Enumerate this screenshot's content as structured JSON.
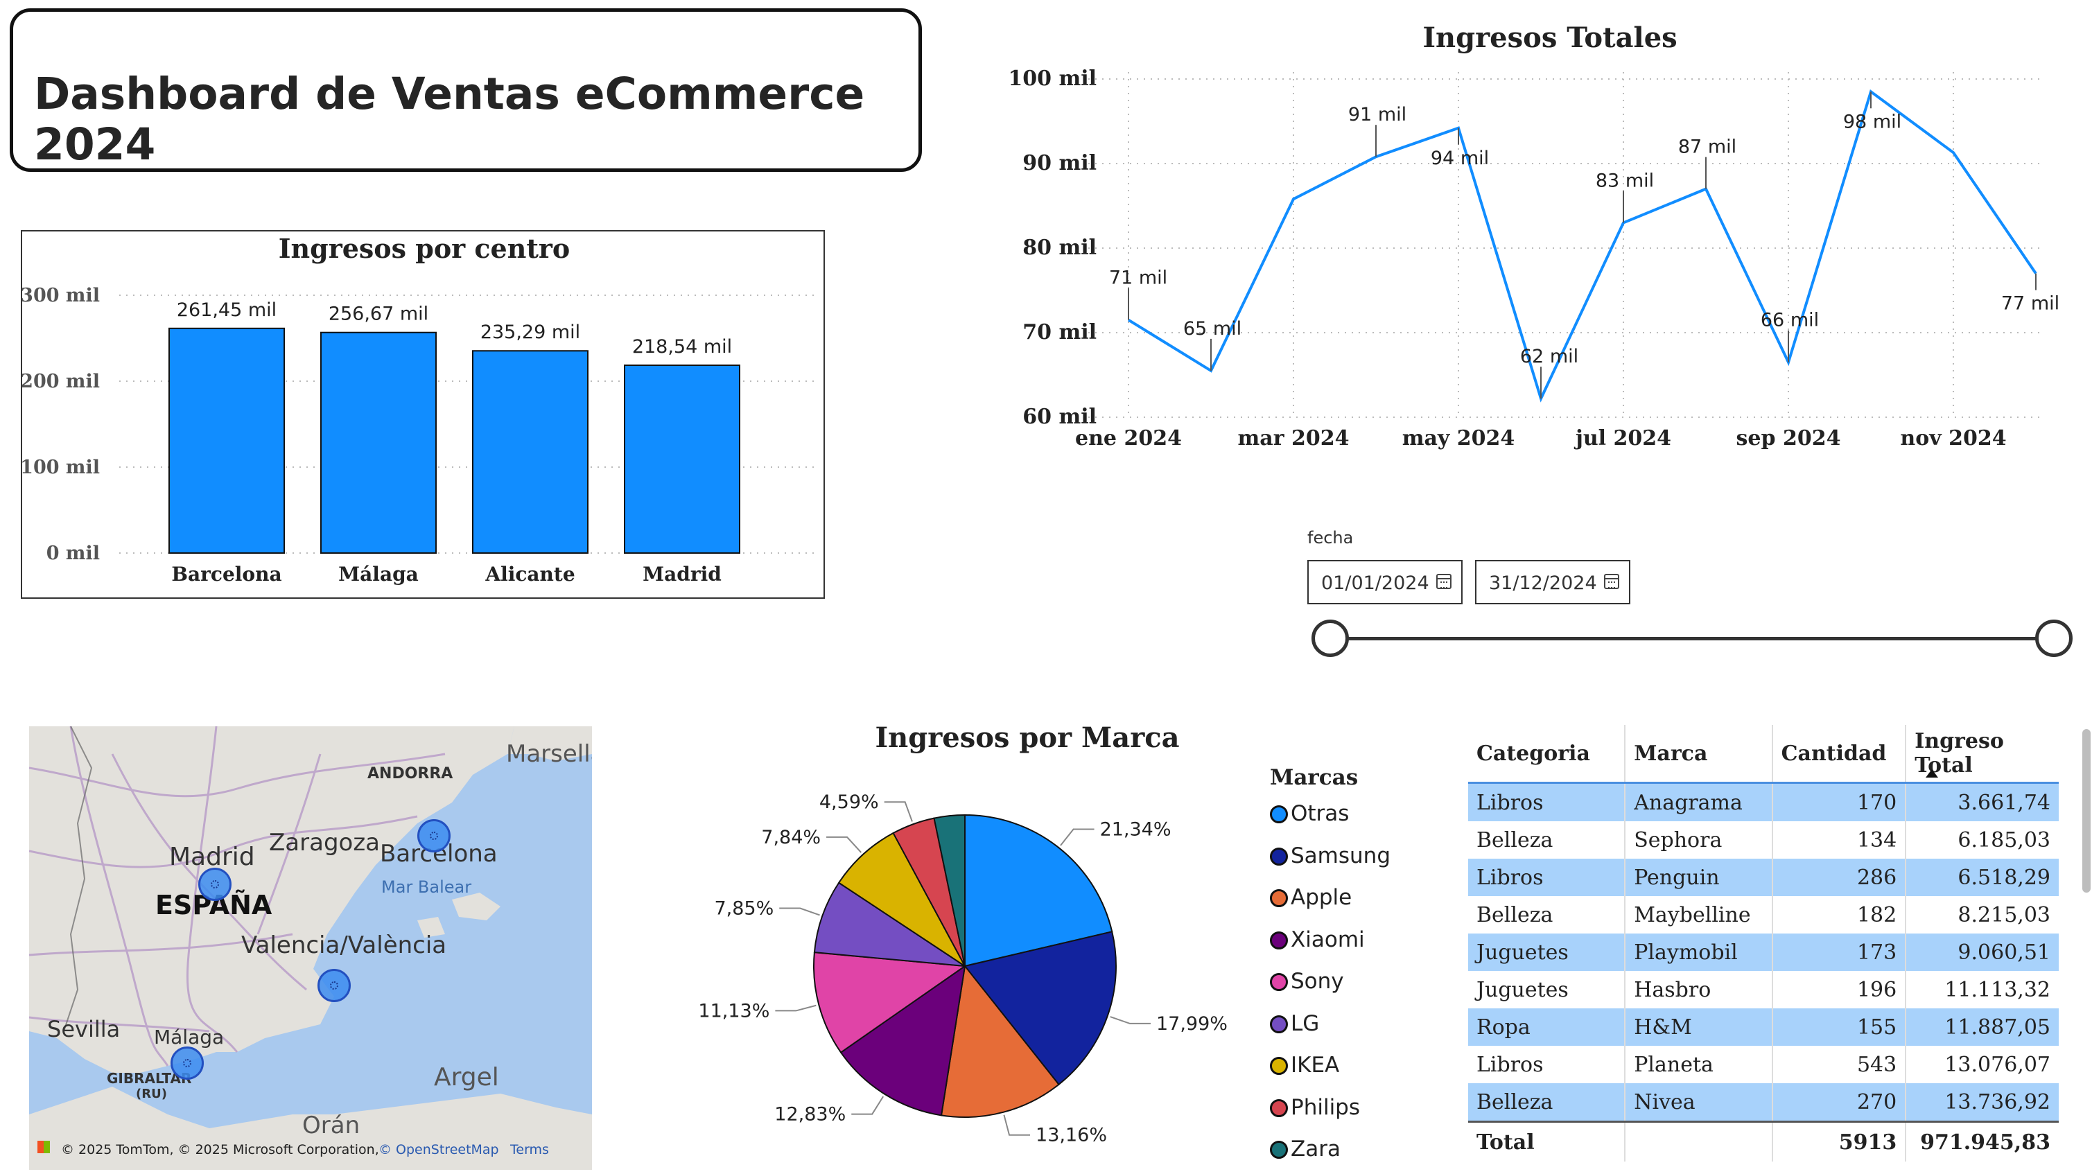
{
  "dashboard": {
    "title": "Dashboard de Ventas eCommerce 2024"
  },
  "bar_chart": {
    "title": "Ingresos por centro",
    "y_ticks": [
      "0 mil",
      "100 mil",
      "200 mil",
      "300 mil"
    ],
    "data_labels": [
      "261,45 mil",
      "256,67 mil",
      "235,29 mil",
      "218,54 mil"
    ],
    "bar_color": "#118DFF"
  },
  "line_chart": {
    "title": "Ingresos Totales",
    "y_ticks": [
      "60 mil",
      "70 mil",
      "80 mil",
      "90 mil",
      "100 mil"
    ],
    "x_ticks": [
      "ene 2024",
      "mar 2024",
      "may 2024",
      "jul 2024",
      "sep 2024",
      "nov 2024"
    ],
    "data_labels": [
      "71 mil",
      "65 mil",
      "91 mil",
      "94 mil",
      "62 mil",
      "83 mil",
      "87 mil",
      "66 mil",
      "98 mil",
      "77 mil"
    ],
    "line_color": "#118DFF"
  },
  "date_slicer": {
    "label": "fecha",
    "start": "01/01/2024",
    "end": "31/12/2024",
    "start_icon": "calendar-icon",
    "end_icon": "calendar-icon"
  },
  "map": {
    "labels": {
      "andorra": "ANDORRA",
      "marsella": "Marsella",
      "madrid": "Madrid",
      "zaragoza": "Zaragoza",
      "barcelona": "Barcelona",
      "mar_balear": "Mar Balear",
      "espana": "ESPAÑA",
      "valencia": "Valencia/València",
      "sevilla": "Sevilla",
      "malaga": "Málaga",
      "gibraltar": "GIBRALTAR",
      "gibraltar_ru": "(RU)",
      "argel": "Argel",
      "oran": "Orán"
    },
    "attribution": "© 2025 TomTom, © 2025 Microsoft Corporation,",
    "osm_link": "© OpenStreetMap",
    "terms_link": "Terms"
  },
  "pie_chart": {
    "title": "Ingresos por Marca",
    "slice_labels": [
      "21,34%",
      "17,99%",
      "13,16%",
      "12,83%",
      "11,13%",
      "7,85%",
      "7,84%",
      "4,59%"
    ]
  },
  "legend": {
    "title": "Marcas",
    "items": [
      {
        "label": "Otras",
        "color": "#118DFF"
      },
      {
        "label": "Samsung",
        "color": "#12239E"
      },
      {
        "label": "Apple",
        "color": "#E66C37"
      },
      {
        "label": "Xiaomi",
        "color": "#6B007B"
      },
      {
        "label": "Sony",
        "color": "#E044A7"
      },
      {
        "label": "LG",
        "color": "#744EC2"
      },
      {
        "label": "IKEA",
        "color": "#D9B300"
      },
      {
        "label": "Philips",
        "color": "#D64550"
      },
      {
        "label": "Zara",
        "color": "#197278"
      }
    ]
  },
  "table": {
    "headers": [
      "Categoria",
      "Marca",
      "Cantidad",
      "Ingreso Total"
    ],
    "rows": [
      [
        "Libros",
        "Anagrama",
        "170",
        "3.661,74"
      ],
      [
        "Belleza",
        "Sephora",
        "134",
        "6.185,03"
      ],
      [
        "Libros",
        "Penguin",
        "286",
        "6.518,29"
      ],
      [
        "Belleza",
        "Maybelline",
        "182",
        "8.215,03"
      ],
      [
        "Juguetes",
        "Playmobil",
        "173",
        "9.060,51"
      ],
      [
        "Juguetes",
        "Hasbro",
        "196",
        "11.113,32"
      ],
      [
        "Ropa",
        "H&M",
        "155",
        "11.887,05"
      ],
      [
        "Libros",
        "Planeta",
        "543",
        "13.076,07"
      ],
      [
        "Belleza",
        "Nivea",
        "270",
        "13.736,92"
      ]
    ],
    "total": [
      "Total",
      "",
      "5913",
      "971.945,83"
    ]
  },
  "chart_data": [
    {
      "type": "bar",
      "title": "Ingresos por centro",
      "categories": [
        "Barcelona",
        "Málaga",
        "Alicante",
        "Madrid"
      ],
      "values": [
        261450,
        256670,
        235290,
        218540
      ],
      "ylim": [
        0,
        300000
      ],
      "grid": true
    },
    {
      "type": "line",
      "title": "Ingresos Totales",
      "x": [
        "2024-01",
        "2024-02",
        "2024-03",
        "2024-04",
        "2024-05",
        "2024-06",
        "2024-07",
        "2024-08",
        "2024-09",
        "2024-10",
        "2024-11",
        "2024-12"
      ],
      "values": [
        71500,
        65500,
        85800,
        90800,
        94200,
        62200,
        83000,
        87000,
        66500,
        98500,
        91300,
        77000
      ],
      "ylim": [
        60000,
        100000
      ],
      "grid": true
    },
    {
      "type": "pie",
      "title": "Ingresos por Marca",
      "categories": [
        "Otras",
        "Samsung",
        "Apple",
        "Xiaomi",
        "Sony",
        "LG",
        "IKEA",
        "Philips",
        "Zara"
      ],
      "values": [
        21.34,
        17.99,
        13.16,
        12.83,
        11.13,
        7.85,
        7.84,
        4.59,
        3.27
      ],
      "legend": "right"
    }
  ]
}
